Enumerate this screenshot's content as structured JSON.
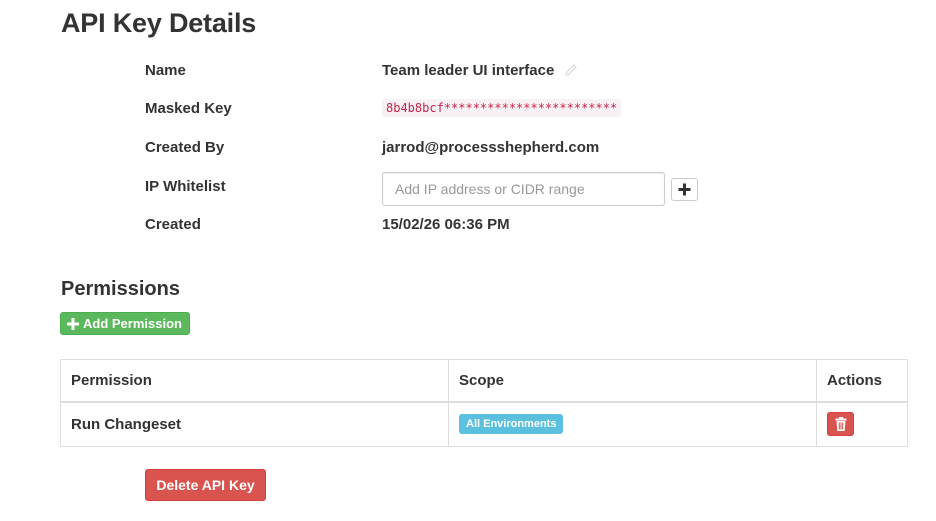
{
  "page": {
    "title": "API Key Details"
  },
  "details": {
    "name_label": "Name",
    "name_value": "Team leader UI interface",
    "masked_key_label": "Masked Key",
    "masked_key_value": "8b4b8bcf************************",
    "created_by_label": "Created By",
    "created_by_value": "jarrod@processshepherd.com",
    "ip_whitelist_label": "IP Whitelist",
    "ip_whitelist_placeholder": "Add IP address or CIDR range",
    "ip_whitelist_value": "",
    "created_label": "Created",
    "created_value": "15/02/26 06:36 PM"
  },
  "permissions": {
    "title": "Permissions",
    "add_label": "Add Permission",
    "columns": [
      "Permission",
      "Scope",
      "Actions"
    ],
    "rows": [
      {
        "permission": "Run Changeset",
        "scope": "All Environments"
      }
    ]
  },
  "actions": {
    "delete_label": "Delete API Key"
  },
  "icons": {
    "edit": "pencil-icon",
    "add_ip": "plus-icon",
    "add_permission": "plus-icon",
    "delete_row": "trash-icon"
  },
  "colors": {
    "success": "#5cb85c",
    "danger": "#d9534f",
    "info": "#5bc0de",
    "code": "#c7254e"
  }
}
